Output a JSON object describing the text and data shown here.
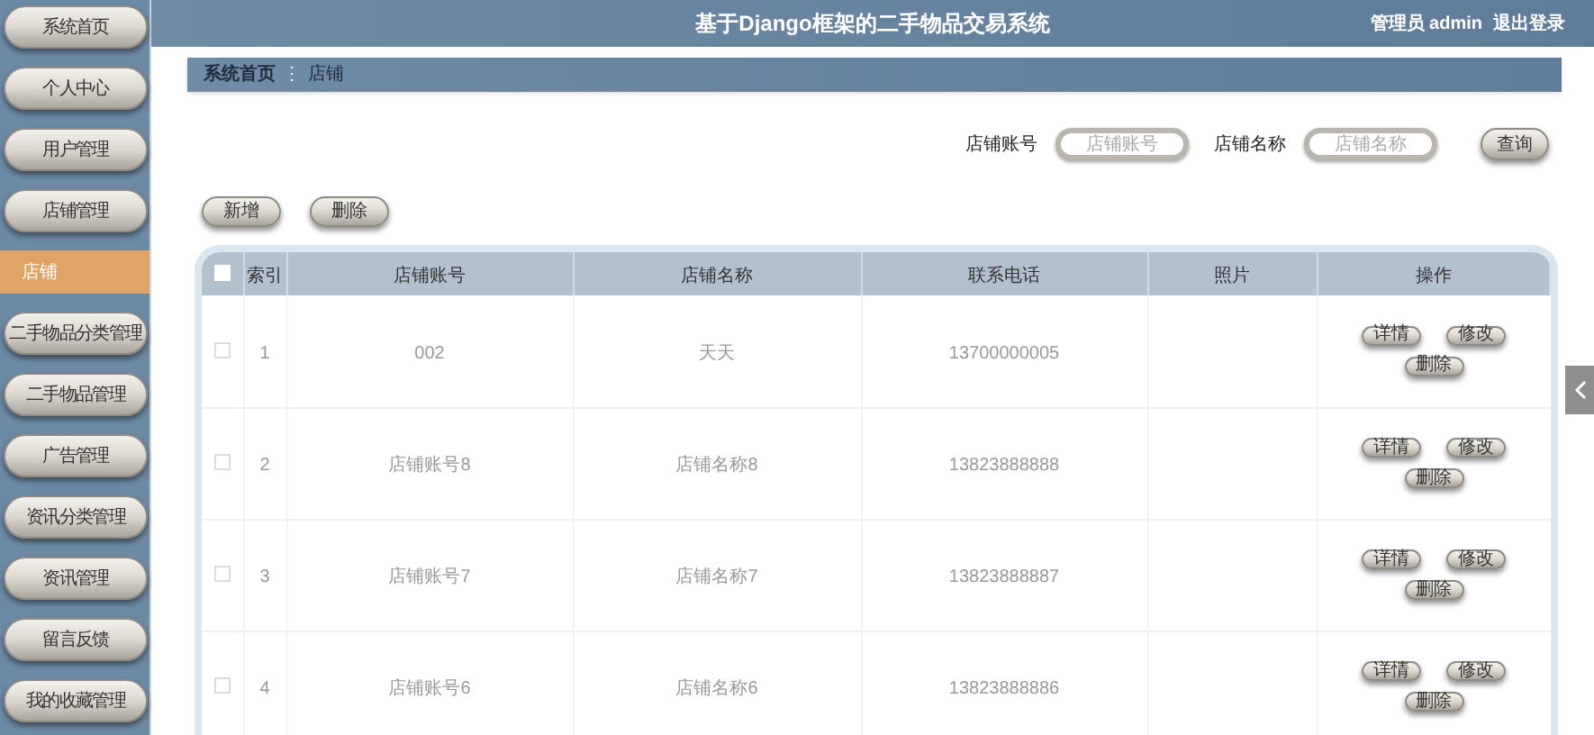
{
  "header": {
    "title": "基于Django框架的二手物品交易系统",
    "user": "管理员 admin",
    "logout": "退出登录"
  },
  "sidebar": {
    "items": [
      {
        "label": "系统首页",
        "selected": false
      },
      {
        "label": "个人中心",
        "selected": false
      },
      {
        "label": "用户管理",
        "selected": false
      },
      {
        "label": "店铺管理",
        "selected": false
      },
      {
        "label": "店铺",
        "selected": true
      },
      {
        "label": "二手物品分类管理",
        "selected": false
      },
      {
        "label": "二手物品管理",
        "selected": false
      },
      {
        "label": "广告管理",
        "selected": false
      },
      {
        "label": "资讯分类管理",
        "selected": false
      },
      {
        "label": "资讯管理",
        "selected": false
      },
      {
        "label": "留言反馈",
        "selected": false
      },
      {
        "label": "我的收藏管理",
        "selected": false
      }
    ]
  },
  "breadcrumb": {
    "home": "系统首页",
    "separator": "⋮",
    "current": "店铺"
  },
  "search": {
    "fields": [
      {
        "label": "店铺账号",
        "placeholder": "店铺账号"
      },
      {
        "label": "店铺名称",
        "placeholder": "店铺名称"
      }
    ],
    "button": "查询"
  },
  "actions": [
    "新增",
    "删除"
  ],
  "table": {
    "select_all_checked": false,
    "columns": [
      "索引",
      "店铺账号",
      "店铺名称",
      "联系电话",
      "照片",
      "操作"
    ],
    "rows": [
      {
        "checked": false,
        "cells": [
          "1",
          "002",
          "天天",
          "13700000005",
          ""
        ],
        "buttons": [
          "详情",
          "修改",
          "删除"
        ]
      },
      {
        "checked": false,
        "cells": [
          "2",
          "店铺账号8",
          "店铺名称8",
          "13823888888",
          ""
        ],
        "buttons": [
          "详情",
          "修改",
          "删除"
        ]
      },
      {
        "checked": false,
        "cells": [
          "3",
          "店铺账号7",
          "店铺名称7",
          "13823888887",
          ""
        ],
        "buttons": [
          "详情",
          "修改",
          "删除"
        ]
      },
      {
        "checked": false,
        "cells": [
          "4",
          "店铺账号6",
          "店铺名称6",
          "13823888886",
          ""
        ],
        "buttons": [
          "详情",
          "修改",
          "删除"
        ]
      }
    ]
  }
}
